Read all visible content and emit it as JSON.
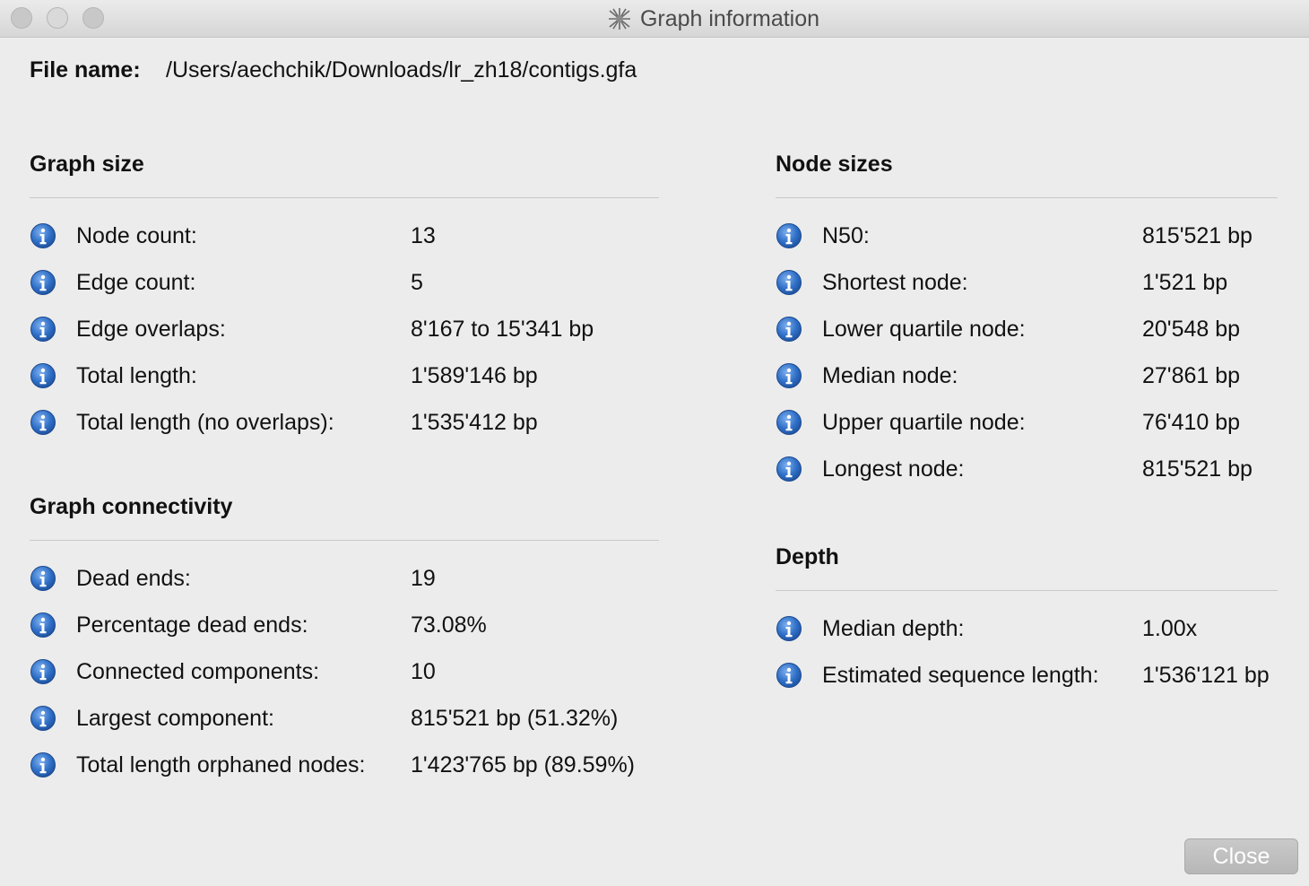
{
  "window": {
    "title": "Graph information"
  },
  "file": {
    "label": "File name:",
    "path": "/Users/aechchik/Downloads/lr_zh18/contigs.gfa"
  },
  "graph_size": {
    "title": "Graph size",
    "rows": [
      {
        "label": "Node count:",
        "value": "13"
      },
      {
        "label": "Edge count:",
        "value": "5"
      },
      {
        "label": "Edge overlaps:",
        "value": "8'167 to 15'341 bp"
      },
      {
        "label": "Total length:",
        "value": "1'589'146 bp"
      },
      {
        "label": "Total length (no overlaps):",
        "value": "1'535'412 bp"
      }
    ]
  },
  "graph_connectivity": {
    "title": "Graph connectivity",
    "rows": [
      {
        "label": "Dead ends:",
        "value": "19"
      },
      {
        "label": "Percentage dead ends:",
        "value": "73.08%"
      },
      {
        "label": "Connected components:",
        "value": "10"
      },
      {
        "label": "Largest component:",
        "value": "815'521 bp (51.32%)"
      },
      {
        "label": "Total length orphaned nodes:",
        "value": "1'423'765 bp (89.59%)"
      }
    ]
  },
  "node_sizes": {
    "title": "Node sizes",
    "rows": [
      {
        "label": "N50:",
        "value": "815'521 bp"
      },
      {
        "label": "Shortest node:",
        "value": "1'521 bp"
      },
      {
        "label": "Lower quartile node:",
        "value": "20'548 bp"
      },
      {
        "label": "Median node:",
        "value": "27'861 bp"
      },
      {
        "label": "Upper quartile node:",
        "value": "76'410 bp"
      },
      {
        "label": "Longest node:",
        "value": "815'521 bp"
      }
    ]
  },
  "depth": {
    "title": "Depth",
    "rows": [
      {
        "label": "Median depth:",
        "value": "1.00x"
      },
      {
        "label": "Estimated sequence length:",
        "value": "1'536'121 bp"
      }
    ]
  },
  "buttons": {
    "close_label": "Close"
  },
  "colors": {
    "info_icon": "#2f6fc7",
    "background": "#ececec",
    "close_button": "#bcbcbc"
  },
  "icons": {
    "row_icon": "info-icon",
    "app_icon": "app-icon"
  }
}
